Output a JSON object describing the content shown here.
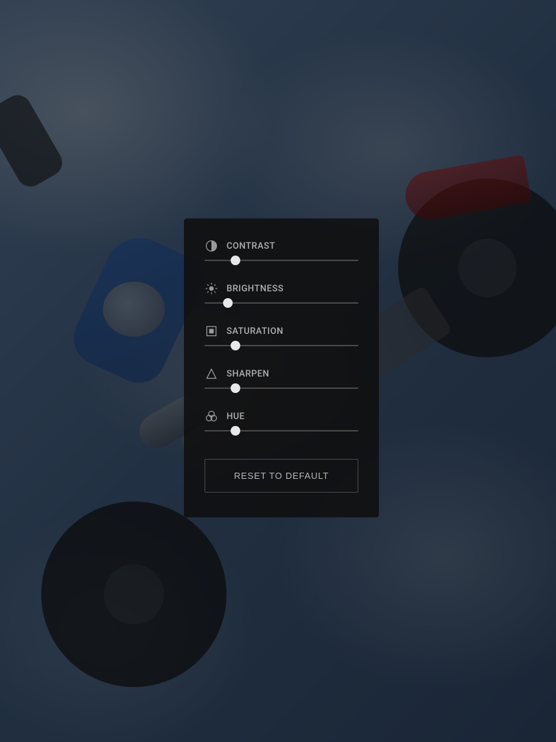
{
  "panel": {
    "controls": [
      {
        "id": "contrast",
        "label": "CONTRAST",
        "icon": "contrast-icon",
        "value": 20
      },
      {
        "id": "brightness",
        "label": "BRIGHTNESS",
        "icon": "brightness-icon",
        "value": 15
      },
      {
        "id": "saturation",
        "label": "SATURATION",
        "icon": "saturation-icon",
        "value": 20
      },
      {
        "id": "sharpen",
        "label": "SHARPEN",
        "icon": "sharpen-icon",
        "value": 20
      },
      {
        "id": "hue",
        "label": "HUE",
        "icon": "hue-icon",
        "value": 20
      }
    ],
    "reset_label": "RESET TO DEFAULT"
  }
}
